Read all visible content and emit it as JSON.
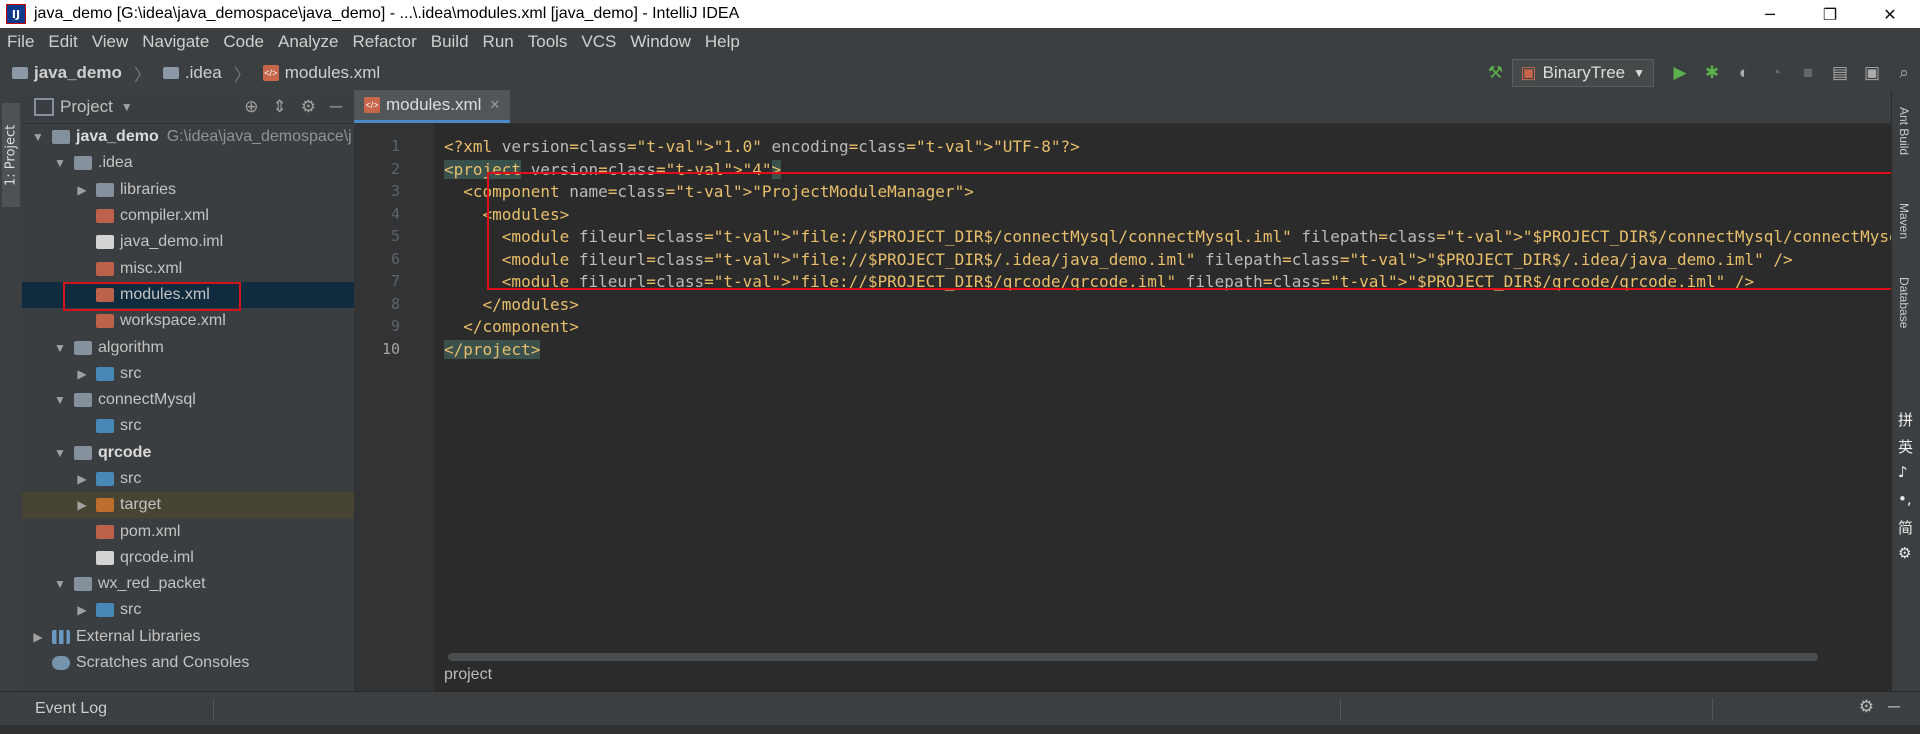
{
  "window": {
    "title": "java_demo [G:\\idea\\java_demospace\\java_demo] - ...\\.idea\\modules.xml [java_demo] - IntelliJ IDEA",
    "app_icon": "intellij-icon",
    "controls": [
      "─",
      "❐",
      "✕"
    ]
  },
  "menu": [
    "File",
    "Edit",
    "View",
    "Navigate",
    "Code",
    "Analyze",
    "Refactor",
    "Build",
    "Run",
    "Tools",
    "VCS",
    "Window",
    "Help"
  ],
  "breadcrumb": {
    "project": "java_demo",
    "folder": ".idea",
    "file": "modules.xml"
  },
  "toolbar": {
    "run_config": "BinaryTree",
    "run_config_arrow": "▼"
  },
  "left_tool_tab": "1: Project",
  "project_panel": {
    "title": "Project",
    "title_arrow": "▼",
    "tree": [
      {
        "label": "java_demo",
        "path": "G:\\idea\\java_demospace\\j",
        "icon": "folder",
        "arrow": "▼",
        "bold": true
      },
      {
        "label": ".idea",
        "icon": "folder",
        "arrow": "▼"
      },
      {
        "label": "libraries",
        "icon": "folder",
        "arrow": "▶"
      },
      {
        "label": "compiler.xml",
        "icon": "xml"
      },
      {
        "label": "java_demo.iml",
        "icon": "iml"
      },
      {
        "label": "misc.xml",
        "icon": "xml"
      },
      {
        "label": "modules.xml",
        "icon": "xml",
        "selected": true
      },
      {
        "label": "workspace.xml",
        "icon": "xml"
      },
      {
        "label": "algorithm",
        "icon": "folder",
        "arrow": "▼"
      },
      {
        "label": "src",
        "icon": "src",
        "arrow": "▶"
      },
      {
        "label": "connectMysql",
        "icon": "folder",
        "arrow": "▼"
      },
      {
        "label": "src",
        "icon": "src"
      },
      {
        "label": "qrcode",
        "icon": "folder",
        "arrow": "▼",
        "bold": true
      },
      {
        "label": "src",
        "icon": "src",
        "arrow": "▶"
      },
      {
        "label": "target",
        "icon": "target",
        "arrow": "▶"
      },
      {
        "label": "pom.xml",
        "icon": "xml"
      },
      {
        "label": "qrcode.iml",
        "icon": "iml"
      },
      {
        "label": "wx_red_packet",
        "icon": "folder",
        "arrow": "▼"
      },
      {
        "label": "src",
        "icon": "src",
        "arrow": "▶"
      },
      {
        "label": "External Libraries",
        "icon": "lib",
        "arrow": "▶"
      },
      {
        "label": "Scratches and Consoles",
        "icon": "scr"
      }
    ]
  },
  "editor": {
    "tab": "modules.xml",
    "tab_close": "✕",
    "line_numbers": [
      "1",
      "2",
      "3",
      "4",
      "5",
      "6",
      "7",
      "8",
      "9",
      "10"
    ],
    "lines": [
      "<?xml version=\"1.0\" encoding=\"UTF-8\"?>",
      "<project version=\"4\">",
      "  <component name=\"ProjectModuleManager\">",
      "    <modules>",
      "      <module fileurl=\"file://$PROJECT_DIR$/connectMysql/connectMysql.iml\" filepath=\"$PROJECT_DIR$/connectMysql/connectMysql.iml\" />",
      "      <module fileurl=\"file://$PROJECT_DIR$/.idea/java_demo.iml\" filepath=\"$PROJECT_DIR$/.idea/java_demo.iml\" />",
      "      <module fileurl=\"file://$PROJECT_DIR$/qrcode/qrcode.iml\" filepath=\"$PROJECT_DIR$/qrcode/qrcode.iml\" />",
      "    </modules>",
      "  </component>",
      "</project>"
    ],
    "footer_breadcrumb": "project",
    "status_mark": "✓"
  },
  "right_tool_tabs": [
    "Ant Build",
    "Maven",
    "Database"
  ],
  "ime_glyphs": [
    "拼",
    "英",
    "♪",
    "•,",
    "简",
    "⚙"
  ],
  "status_bar": {
    "event_log": "Event Log",
    "settings_icon": "⚙",
    "minimize_icon": "─"
  }
}
